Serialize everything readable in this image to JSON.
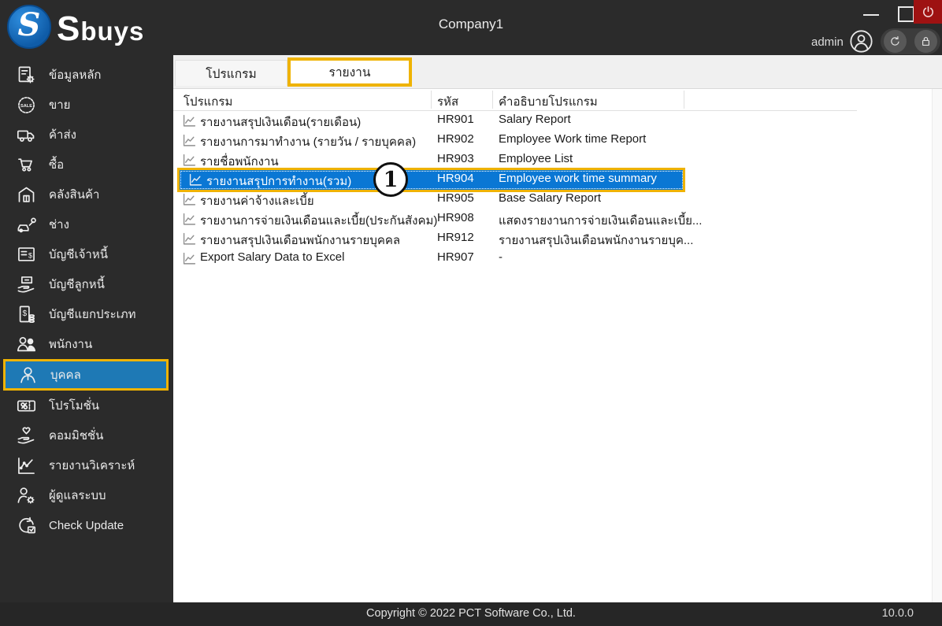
{
  "header": {
    "brand": "Sbuys",
    "title": "Company1",
    "user": "admin",
    "window_controls": [
      "minimize",
      "maximize",
      "power"
    ],
    "user_tools": [
      "refresh",
      "lock"
    ]
  },
  "sidebar": {
    "items": [
      {
        "id": "master-data",
        "icon": "master-data",
        "label": "ข้อมูลหลัก",
        "selected": false
      },
      {
        "id": "sale",
        "icon": "sale",
        "label": "ขาย",
        "selected": false
      },
      {
        "id": "wholesale",
        "icon": "wholesale",
        "label": "ค้าส่ง",
        "selected": false
      },
      {
        "id": "purchase",
        "icon": "purchase",
        "label": "ซื้อ",
        "selected": false
      },
      {
        "id": "warehouse",
        "icon": "warehouse",
        "label": "คลังสินค้า",
        "selected": false
      },
      {
        "id": "service",
        "icon": "service",
        "label": "ช่าง",
        "selected": false
      },
      {
        "id": "accounts-payable",
        "icon": "accounts-payable",
        "label": "บัญชีเจ้าหนี้",
        "selected": false
      },
      {
        "id": "accounts-receivable",
        "icon": "accounts-receivable",
        "label": "บัญชีลูกหนี้",
        "selected": false
      },
      {
        "id": "general-ledger",
        "icon": "general-ledger",
        "label": "บัญชีแยกประเภท",
        "selected": false
      },
      {
        "id": "employees",
        "icon": "employees",
        "label": "พนักงาน",
        "selected": false
      },
      {
        "id": "person",
        "icon": "person",
        "label": "บุคคล",
        "selected": true
      },
      {
        "id": "promotion",
        "icon": "promotion",
        "label": "โปรโมชั่น",
        "selected": false
      },
      {
        "id": "commission",
        "icon": "commission",
        "label": "คอมมิชชั่น",
        "selected": false
      },
      {
        "id": "analysis-report",
        "icon": "analysis-report",
        "label": "รายงานวิเคราะห์",
        "selected": false
      },
      {
        "id": "system-admin",
        "icon": "system-admin",
        "label": "ผู้ดูแลระบบ",
        "selected": false
      },
      {
        "id": "check-update",
        "icon": "check-update",
        "label": "Check Update",
        "selected": false
      }
    ]
  },
  "tabs": [
    {
      "label": "โปรแกรม",
      "active": false
    },
    {
      "label": "รายงาน",
      "active": true
    }
  ],
  "table": {
    "columns": [
      "โปรแกรม",
      "รหัส",
      "คำอธิบายโปรแกรม"
    ],
    "rows": [
      {
        "name": "รายงานสรุปเงินเดือน(รายเดือน)",
        "code": "HR901",
        "desc": "Salary Report",
        "selected": false
      },
      {
        "name": "รายงานการมาทำงาน (รายวัน / รายบุคคล)",
        "code": "HR902",
        "desc": "Employee Work time Report",
        "selected": false
      },
      {
        "name": "รายชื่อพนักงาน",
        "code": "HR903",
        "desc": "Employee List",
        "selected": false
      },
      {
        "name": "รายงานสรุปการทำงาน(รวม)",
        "code": "HR904",
        "desc": "Employee work time summary",
        "selected": true
      },
      {
        "name": "รายงานค่าจ้างและเบี้ย",
        "code": "HR905",
        "desc": "Base Salary Report",
        "selected": false
      },
      {
        "name": "รายงานการจ่ายเงินเดือนและเบี้ย(ประกันสังคม)",
        "code": "HR908",
        "desc": "แสดงรายงานการจ่ายเงินเดือนและเบี้ย...",
        "selected": false
      },
      {
        "name": "รายงานสรุปเงินเดือนพนักงานรายบุคคล",
        "code": "HR912",
        "desc": "รายงานสรุปเงินเดือนพนักงานรายบุค...",
        "selected": false
      },
      {
        "name": "Export Salary Data to Excel",
        "code": "HR907",
        "desc": "-",
        "selected": false
      }
    ]
  },
  "annotation": {
    "step": "1"
  },
  "footer": {
    "copyright": "Copyright © 2022 PCT Software Co., Ltd.",
    "version": "10.0.0"
  },
  "colors": {
    "titlebar_bg": "#2b2b2b",
    "statusbar_bg": "#262626",
    "highlight_border": "#efb300",
    "row_selected_bg": "#0a77d4",
    "sidebar_selected_bg": "#1e79b5",
    "power_button_bg": "#9e1212",
    "logo_blue": "#0f5ca8"
  }
}
